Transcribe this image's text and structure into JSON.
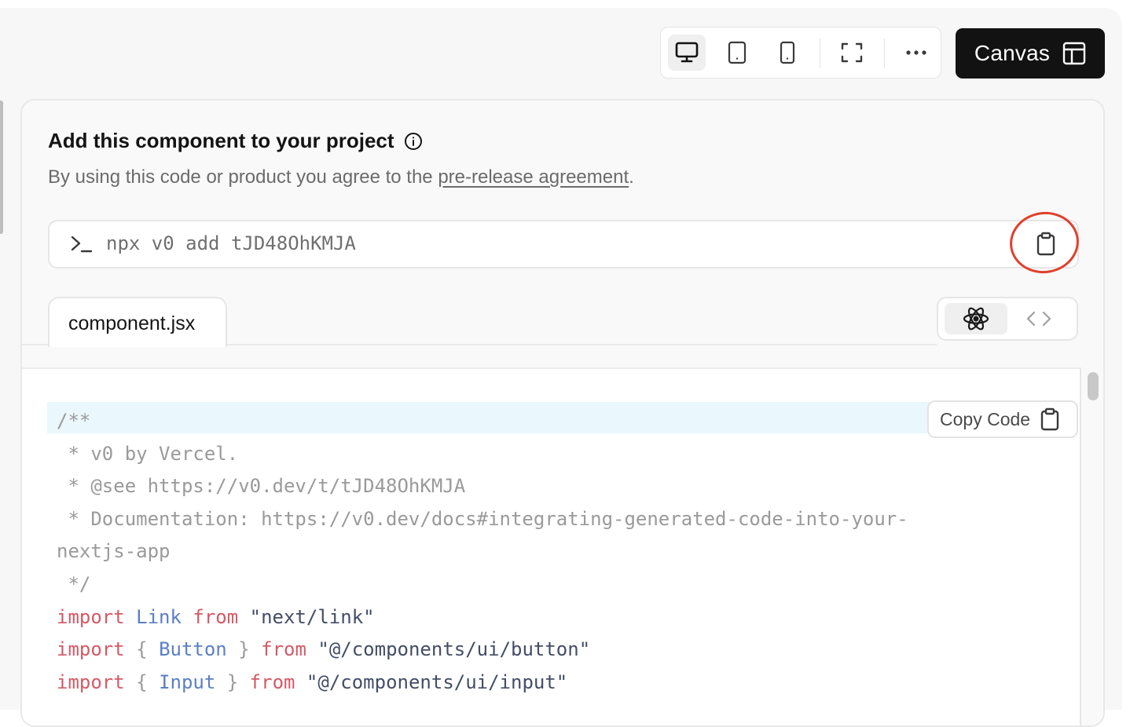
{
  "toolbar": {
    "viewport_buttons": [
      {
        "name": "desktop",
        "icon": "monitor-icon",
        "active": true
      },
      {
        "name": "tablet",
        "icon": "tablet-icon",
        "active": false
      },
      {
        "name": "mobile",
        "icon": "smartphone-icon",
        "active": false
      },
      {
        "name": "fullscreen",
        "icon": "fullscreen-icon",
        "active": false
      },
      {
        "name": "more",
        "icon": "ellipsis-icon",
        "active": false
      }
    ],
    "canvas_label": "Canvas",
    "canvas_icon": "layout-panel-icon"
  },
  "card": {
    "title": "Add this component to your project",
    "title_icon": "info-icon",
    "subtitle_prefix": "By using this code or product you agree to the ",
    "subtitle_link": "pre-release agreement",
    "subtitle_suffix": ".",
    "command": "npx v0 add tJD48OhKMJA",
    "command_icon": "terminal-prompt-icon",
    "command_copy_icon": "clipboard-icon",
    "annotation_color": "#e0402c"
  },
  "file_tab": {
    "label": "component.jsx"
  },
  "code_view_toggle": [
    {
      "name": "react",
      "icon": "react-icon",
      "active": true
    },
    {
      "name": "code",
      "icon": "code-brackets-icon",
      "active": false
    }
  ],
  "copy_code": {
    "label": "Copy Code",
    "icon": "clipboard-icon"
  },
  "code_lines": {
    "l1": "/**",
    "l2": " * v0 by Vercel.",
    "l3": " * @see https://v0.dev/t/tJD48OhKMJA",
    "l4": " * Documentation: https://v0.dev/docs#integrating-generated-code-into-your-",
    "l5": "nextjs-app",
    "l6": " */",
    "kw_import": "import",
    "kw_from": "from",
    "link_id": "Link",
    "link_src": "\"next/link\"",
    "button_id": "Button",
    "button_src": "\"@/components/ui/button\"",
    "input_id": "Input",
    "input_src": "\"@/components/ui/input\"",
    "brace_open": "{",
    "brace_close": "}"
  },
  "colors": {
    "canvas_button_bg": "#121212",
    "keyword": "#d45a66",
    "identifier": "#5b7fc4",
    "string": "#434d66",
    "comment": "#9a9a9a",
    "highlight": "#eaf7fd"
  }
}
